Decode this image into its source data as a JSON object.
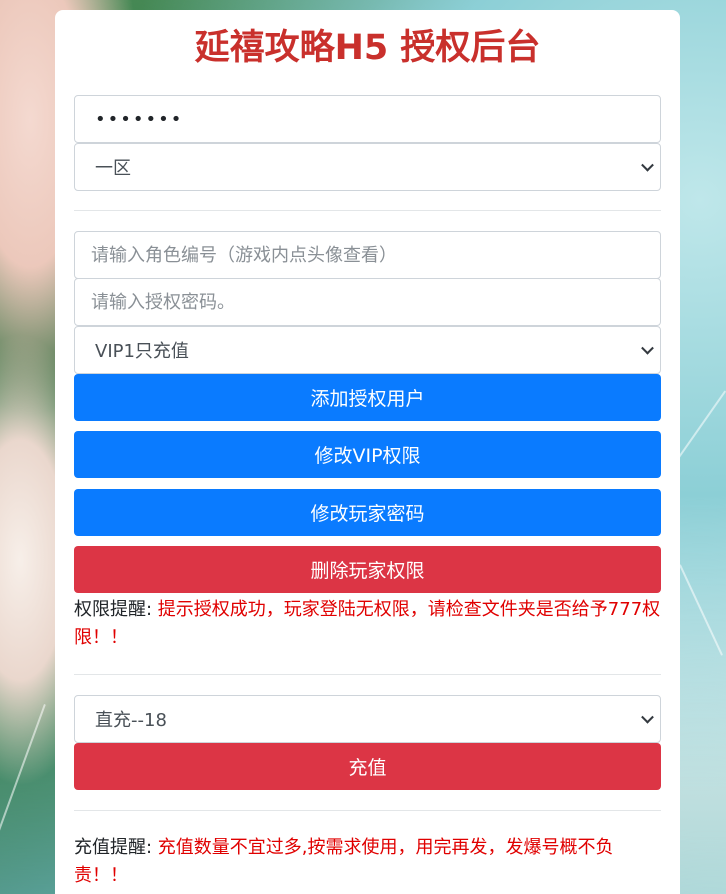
{
  "page": {
    "title": "延禧攻略H5 授权后台"
  },
  "login": {
    "password_value": "•••••••",
    "server_select": "一区"
  },
  "auth": {
    "role_id_placeholder": "请输入角色编号（游戏内点头像查看）",
    "auth_password_placeholder": "请输入授权密码。",
    "vip_select": "VIP1只充值",
    "add_button": "添加授权用户",
    "modify_vip_button": "修改VIP权限",
    "modify_password_button": "修改玩家密码",
    "delete_button": "删除玩家权限",
    "notice_label": "权限提醒: ",
    "notice_message": "提示授权成功，玩家登陆无权限，请检查文件夹是否给予777权限！！"
  },
  "recharge": {
    "amount_select": "直充--18",
    "submit_button": "充值",
    "notice_label": "充值提醒: ",
    "notice_message": "充值数量不宜过多,按需求使用，用完再发，发爆号概不负责！！"
  },
  "colors": {
    "title": "#c9302c",
    "primary": "#0a7bff",
    "danger": "#dc3545",
    "notice": "#e00000"
  }
}
